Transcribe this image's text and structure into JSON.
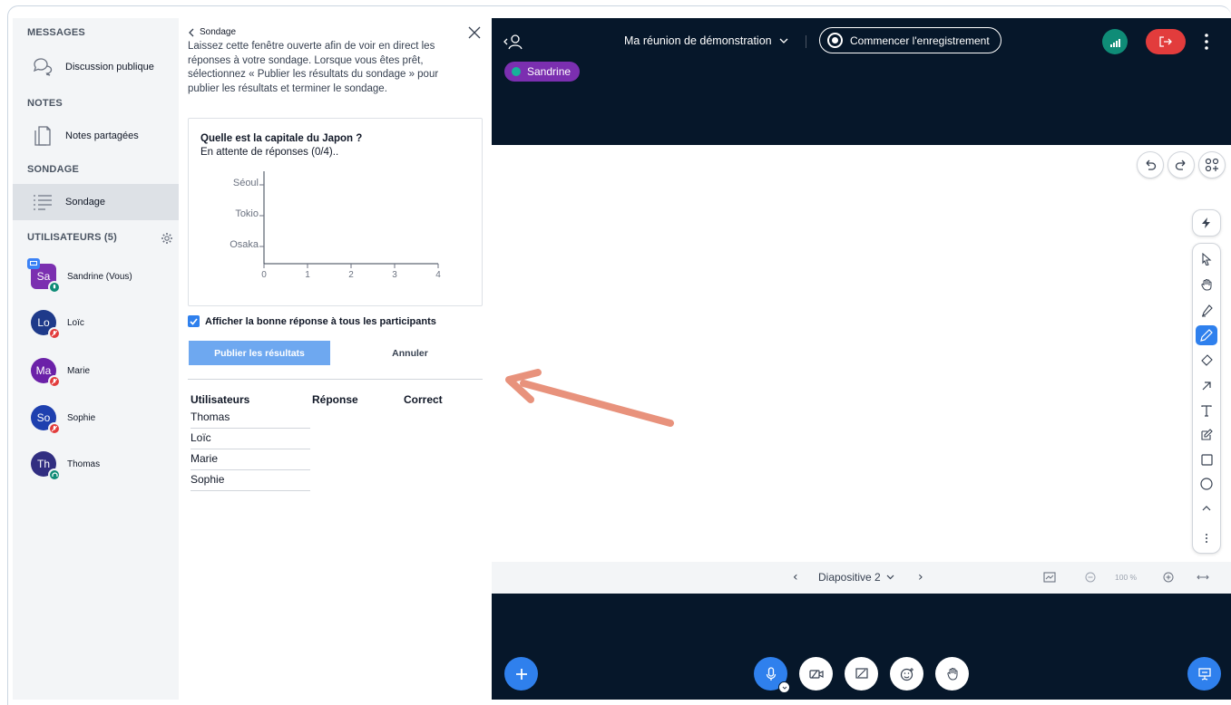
{
  "sidebar": {
    "messages_title": "MESSAGES",
    "public_chat": "Discussion publique",
    "notes_title": "NOTES",
    "shared_notes": "Notes partagées",
    "poll_title": "SONDAGE",
    "poll_item": "Sondage",
    "users_title": "UTILISATEURS (5)",
    "users": [
      {
        "initials": "Sa",
        "name": "Sandrine (Vous)",
        "color": "#7b2fb0",
        "status": "ok"
      },
      {
        "initials": "Lo",
        "name": "Loïc",
        "color": "#1e3a8a",
        "status": "muted"
      },
      {
        "initials": "Ma",
        "name": "Marie",
        "color": "#6b21a8",
        "status": "muted"
      },
      {
        "initials": "So",
        "name": "Sophie",
        "color": "#1e40af",
        "status": "muted"
      },
      {
        "initials": "Th",
        "name": "Thomas",
        "color": "#312e81",
        "status": "listen"
      }
    ]
  },
  "poll": {
    "back_label": "Sondage",
    "help": "Laissez cette fenêtre ouverte afin de voir en direct les réponses à votre sondage. Lorsque vous êtes prêt, sélectionnez « Publier les résultats du sondage » pour publier les résultats et terminer le sondage.",
    "question": "Quelle est la capitale du Japon ?",
    "waiting": "En attente de réponses (0/4)..",
    "show_answer_label": "Afficher la bonne réponse à tous les participants",
    "publish_label": "Publier les résultats",
    "cancel_label": "Annuler",
    "col_users": "Utilisateurs",
    "col_answer": "Réponse",
    "col_correct": "Correct",
    "rows": [
      "Thomas",
      "Loïc",
      "Marie",
      "Sophie"
    ]
  },
  "chart_data": {
    "type": "bar",
    "orientation": "horizontal",
    "categories": [
      "Séoul",
      "Tokio",
      "Osaka"
    ],
    "values": [
      0,
      0,
      0
    ],
    "xlim": [
      0,
      4
    ],
    "xticks": [
      "0",
      "1",
      "2",
      "3",
      "4"
    ]
  },
  "topbar": {
    "meeting_title": "Ma réunion de démonstration",
    "record_label": "Commencer l'enregistrement",
    "talker": "Sandrine"
  },
  "slides": {
    "current": "Diapositive 2",
    "zoom": "100 %"
  },
  "colors": {
    "accent": "#2f80ed",
    "dark_bg": "#06172a",
    "leave": "#e23c3c",
    "ok": "#0f8c77",
    "arrow": "#e8927c"
  }
}
